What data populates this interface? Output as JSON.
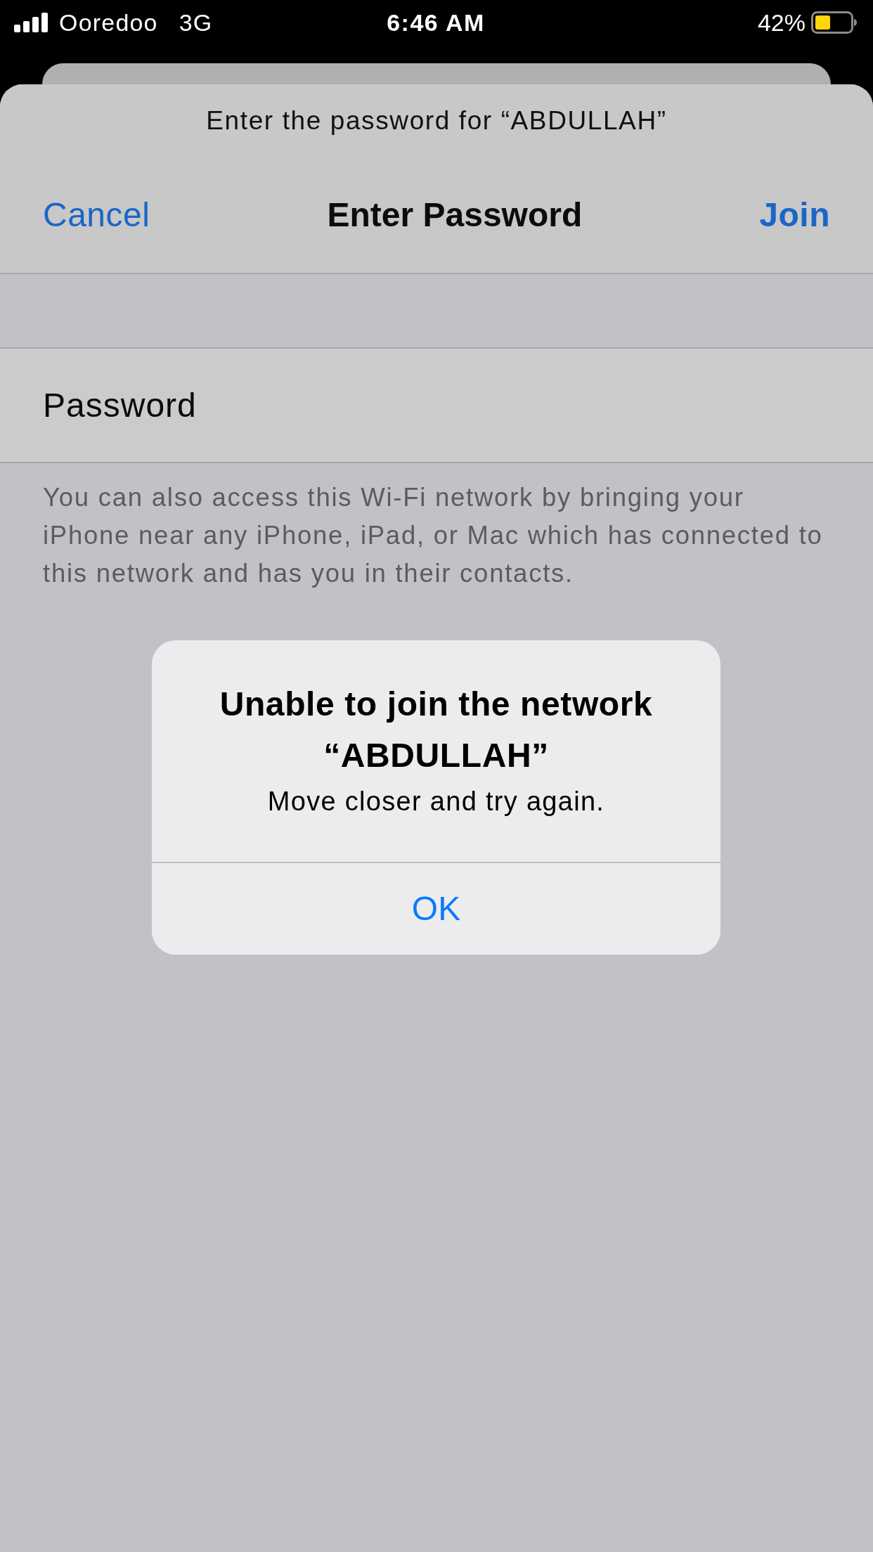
{
  "status_bar": {
    "carrier": "Ooredoo",
    "network": "3G",
    "time": "6:46 AM",
    "battery": "42%"
  },
  "sheet": {
    "prompt": "Enter the password for “ABDULLAH”",
    "cancel_button": "Cancel",
    "title": "Enter Password",
    "join_button": "Join",
    "password_field": {
      "label": "Password"
    },
    "footer": "You can also access this Wi-Fi network by bringing your iPhone near any iPhone, iPad, or Mac which has connected to this network and has you in their contacts."
  },
  "alert": {
    "title": "Unable to join the network “ABDULLAH”",
    "message": "Move closer and try again.",
    "buttons": [
      "OK"
    ]
  }
}
